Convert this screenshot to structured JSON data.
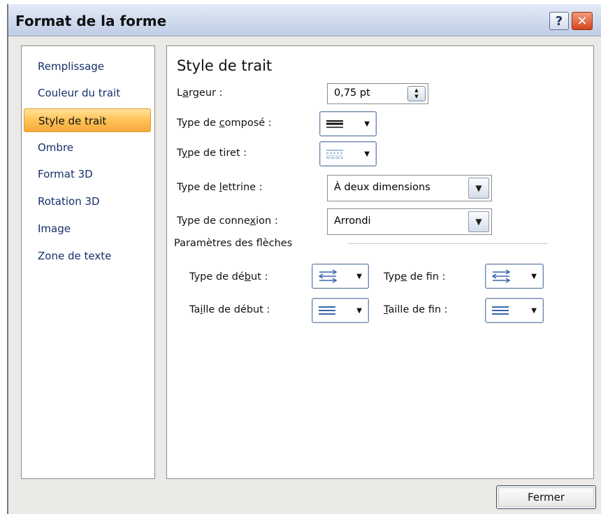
{
  "window": {
    "title": "Format de la forme",
    "help_glyph": "?",
    "close_glyph": "✕"
  },
  "nav": {
    "items": [
      {
        "label": "Remplissage",
        "selected": false
      },
      {
        "label": "Couleur du trait",
        "selected": false
      },
      {
        "label": "Style de trait",
        "selected": true
      },
      {
        "label": "Ombre",
        "selected": false
      },
      {
        "label": "Format 3D",
        "selected": false
      },
      {
        "label": "Rotation 3D",
        "selected": false
      },
      {
        "label": "Image",
        "selected": false
      },
      {
        "label": "Zone de texte",
        "selected": false
      }
    ]
  },
  "panel": {
    "heading": "Style de trait",
    "largeur": {
      "label_pre": "L",
      "label_acc": "a",
      "label_post": "rgeur :",
      "value": "0,75 pt"
    },
    "compose": {
      "label_pre": "Type de ",
      "label_acc": "c",
      "label_post": "omposé :",
      "icon": "compound-lines-icon"
    },
    "tiret": {
      "label_pre": "T",
      "label_acc": "y",
      "label_post": "pe de tiret :",
      "icon": "dash-lines-icon"
    },
    "lettrine": {
      "label_pre": "Type de ",
      "label_acc": "l",
      "label_post": "ettrine :",
      "value": "À deux dimensions"
    },
    "connexion": {
      "label_pre": "Type de conne",
      "label_acc": "x",
      "label_post": "ion :",
      "value": "Arrondi"
    },
    "fleches": {
      "section_label": "Paramètres des flèches",
      "type_debut": {
        "label_pre": "Type de dé",
        "label_acc": "b",
        "label_post": "ut :",
        "icon": "arrow-type-icon"
      },
      "type_fin": {
        "label_pre": "Typ",
        "label_acc": "e",
        "label_post": " de fin :",
        "icon": "arrow-type-icon"
      },
      "taille_debut": {
        "label_pre": "Ta",
        "label_acc": "i",
        "label_post": "lle de début :",
        "icon": "arrow-size-icon"
      },
      "taille_fin": {
        "label_pre": "",
        "label_acc": "T",
        "label_post": "aille de fin :",
        "icon": "arrow-size-icon"
      }
    }
  },
  "footer": {
    "close_label": "Fermer"
  },
  "colors": {
    "selection_gradient_top": "#ffe39a",
    "selection_gradient_bottom": "#f7a93b",
    "titlebar": "#cfdaed",
    "close_button": "#d4451c",
    "nav_text": "#15306a"
  }
}
